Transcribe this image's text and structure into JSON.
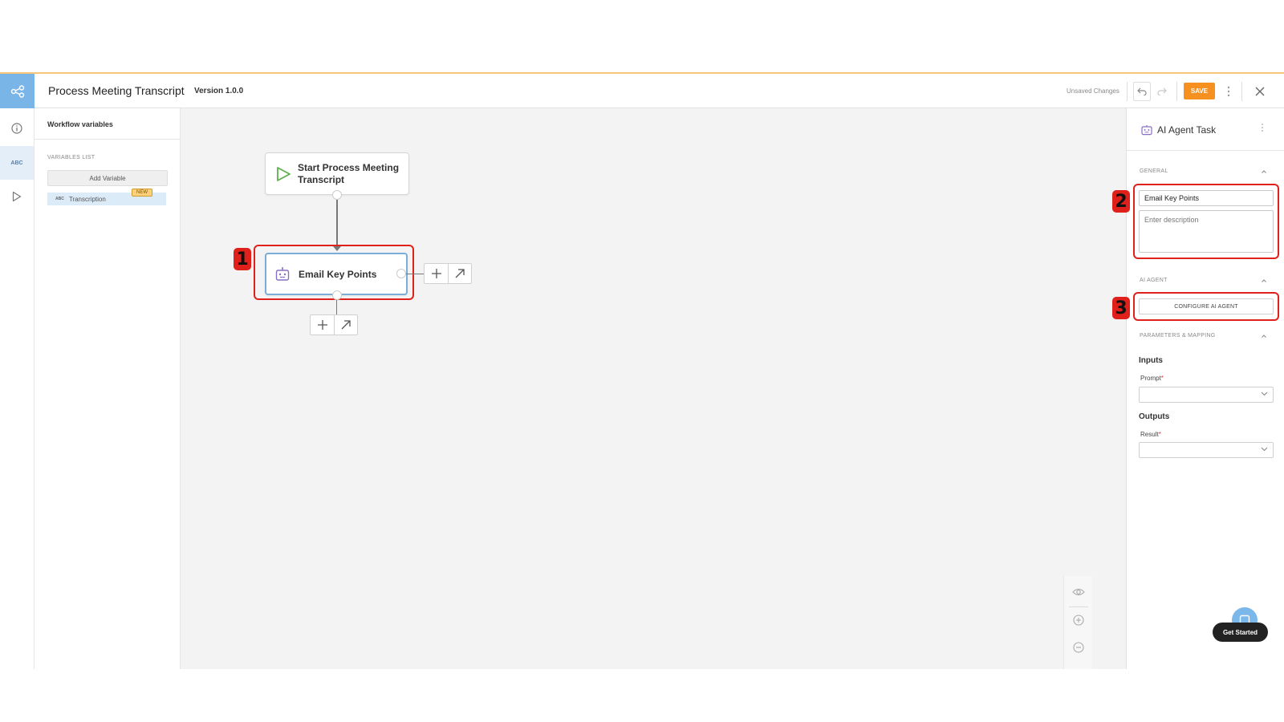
{
  "header": {
    "title": "Process Meeting Transcript",
    "version": "Version 1.0.0",
    "unsaved": "Unsaved Changes",
    "save_label": "SAVE"
  },
  "rail": {
    "items": [
      "info",
      "variables",
      "run"
    ],
    "variables_label": "ABC"
  },
  "variables_panel": {
    "title": "Workflow variables",
    "list_label": "VARIABLES LIST",
    "add_button": "Add Variable",
    "items": [
      {
        "type": "ABC",
        "name": "Transcription",
        "badge": "NEW"
      }
    ]
  },
  "canvas": {
    "start_node": {
      "label": "Start Process Meeting Transcript"
    },
    "task_node": {
      "label": "Email Key Points"
    }
  },
  "callouts": [
    "1",
    "2",
    "3"
  ],
  "properties": {
    "title": "AI Agent Task",
    "general_label": "GENERAL",
    "name_value": "Email Key Points",
    "description_placeholder": "Enter description",
    "ai_agent_label": "AI AGENT",
    "configure_button": "CONFIGURE AI AGENT",
    "params_label": "PARAMETERS & MAPPING",
    "inputs_heading": "Inputs",
    "prompt_label": "Prompt",
    "outputs_heading": "Outputs",
    "result_label": "Result",
    "required_mark": "*"
  },
  "help": {
    "button": "Get Started"
  },
  "colors": {
    "accent": "#7ab5e8",
    "save": "#f6901e",
    "callout": "#e0201a",
    "badge": "#ffd27a"
  }
}
